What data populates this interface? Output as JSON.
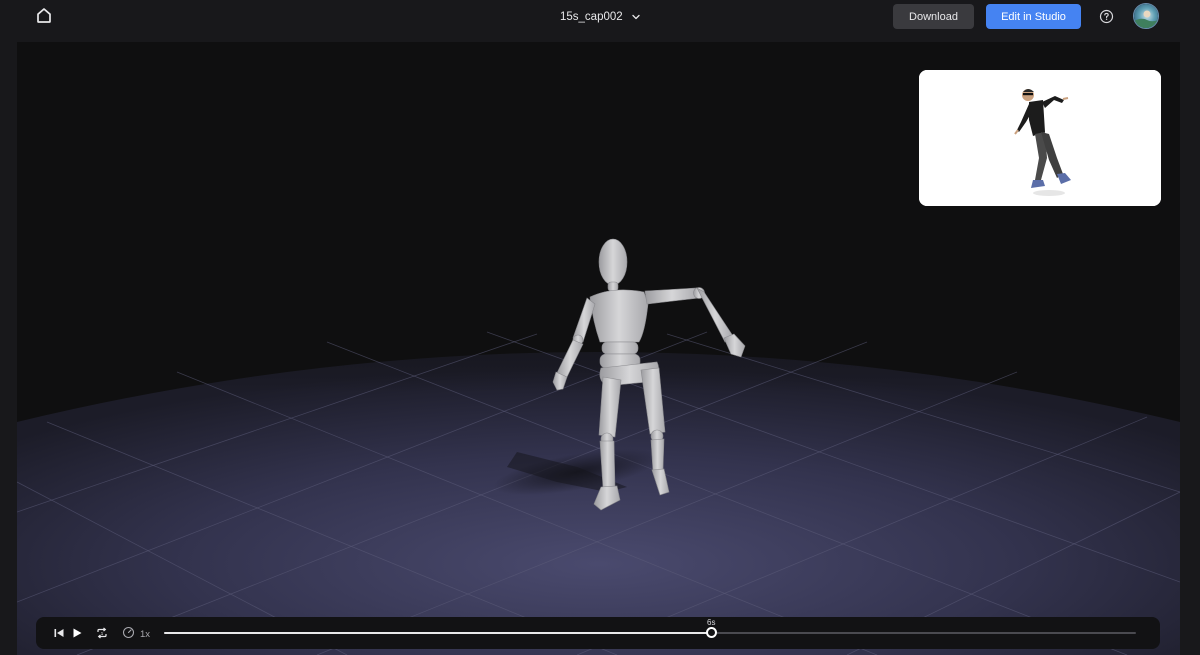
{
  "header": {
    "home_icon": "home-icon",
    "file_name": "15s_cap002",
    "dropdown_icon": "chevron-down-icon",
    "download_label": "Download",
    "edit_studio_label": "Edit in Studio",
    "help_icon": "help-circle-icon",
    "avatar_icon": "user-avatar"
  },
  "viewport": {
    "scene": "3d-mannequin-on-grid-floor",
    "reference_video": "dancer-reference-thumbnail"
  },
  "player": {
    "icons": [
      "skip-back-icon",
      "play-icon",
      "loop-icon",
      "speed-icon"
    ],
    "speed_label": "1x",
    "current_time_label": "6s",
    "progress": 0.563
  },
  "colors": {
    "background": "#18181b",
    "accent": "#4583f2",
    "secondary_button": "#3a3a3e",
    "floor": "#3a3a58"
  }
}
